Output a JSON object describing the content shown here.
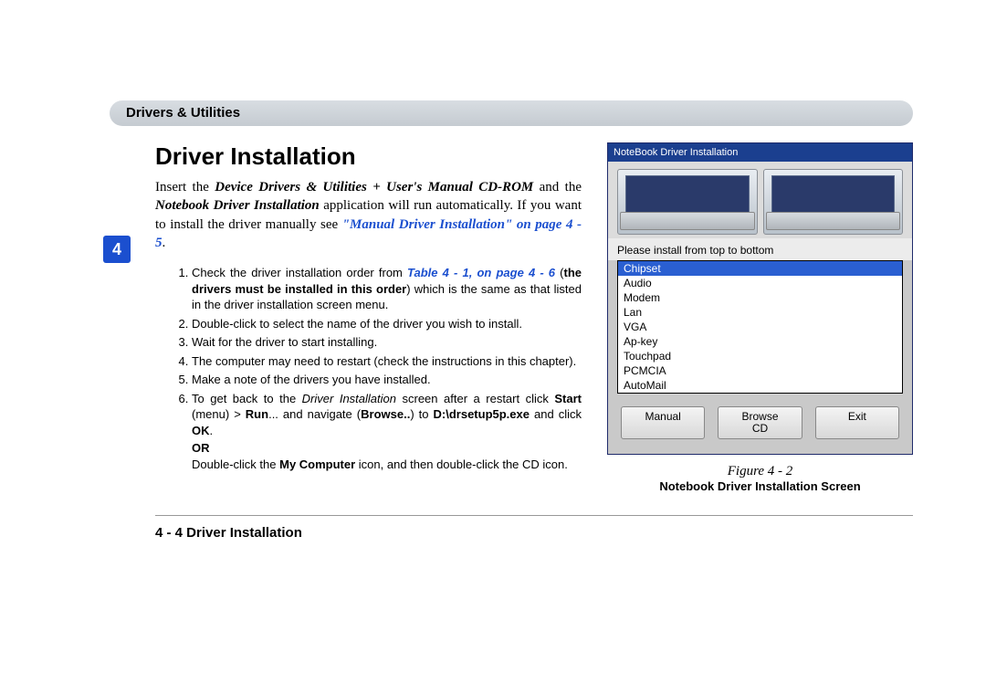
{
  "header": {
    "breadcrumb": "Drivers & Utilities"
  },
  "chapter_tab": "4",
  "title": "Driver Installation",
  "intro": {
    "t1": "Insert the ",
    "b1": "Device Drivers & Utilities + User's Manual CD-ROM",
    "t2": " and the ",
    "b2": "Notebook Driver Installation",
    "t3": " application will run automatically. If you want to install the driver manually see ",
    "xref": "\"Manual Driver Installation\" on page 4 - 5",
    "t4": "."
  },
  "steps": {
    "s1a": "Check the driver installation order from ",
    "s1xref": "Table 4 - 1, on page 4 - 6",
    "s1b": " (",
    "s1bold": "the drivers must be installed in this order",
    "s1c": ") which is the same as that listed in the driver installation screen menu.",
    "s2": "Double-click to select the name of the driver you wish to install.",
    "s3": "Wait for the driver to start installing.",
    "s4": "The computer may need to restart (check the instructions in this chapter).",
    "s5": "Make a note of the drivers you have installed.",
    "s6a": "To get back to the ",
    "s6i": "Driver Installation",
    "s6b": " screen after a restart click ",
    "s6bold1": "Start",
    "s6c": " (menu) > ",
    "s6bold2": "Run",
    "s6d": "... and navigate (",
    "s6bold3": "Browse..",
    "s6e": ") to ",
    "s6bold4": "D:\\drsetup5p.exe",
    "s6f": " and click ",
    "s6bold5": "OK",
    "s6g": ".",
    "or": "OR",
    "alt_a": "Double-click the ",
    "alt_b": "My Computer",
    "alt_c": " icon, and then double-click the CD icon."
  },
  "figure": {
    "window_title": "NoteBook Driver Installation",
    "note": "Please install from top to bottom",
    "drivers": [
      "Chipset",
      "Audio",
      "Modem",
      "Lan",
      "VGA",
      "Ap-key",
      "Touchpad",
      "PCMCIA",
      "AutoMail"
    ],
    "btn_manual": "Manual",
    "btn_browse": "Browse\nCD",
    "btn_exit": "Exit",
    "fig_num": "Figure 4 - 2",
    "fig_name": "Notebook Driver Installation Screen"
  },
  "footer": "4 - 4 Driver Installation"
}
